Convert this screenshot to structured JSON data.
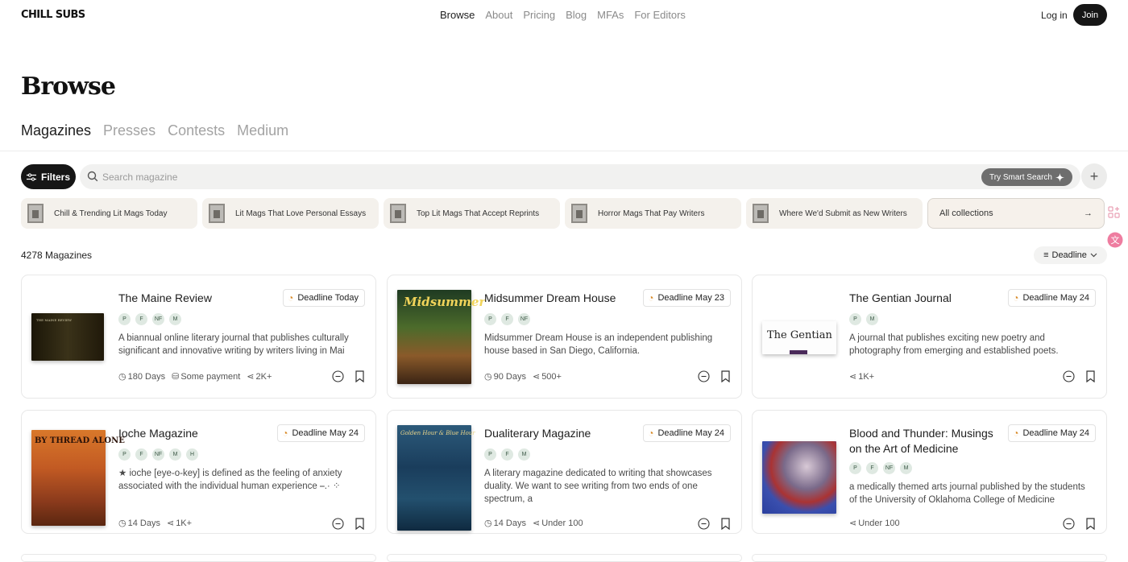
{
  "brand": "CHILL SUBS",
  "nav": [
    "Browse",
    "About",
    "Pricing",
    "Blog",
    "MFAs",
    "For Editors"
  ],
  "auth": {
    "login": "Log in",
    "join": "Join"
  },
  "page_title": "Browse",
  "tabs": [
    "Magazines",
    "Presses",
    "Contests",
    "Medium"
  ],
  "toolbar": {
    "filters": "Filters",
    "search_placeholder": "Search magazine",
    "smart_search": "Try Smart Search"
  },
  "collections": [
    "Chill & Trending Lit Mags Today",
    "Lit Mags That Love Personal Essays",
    "Top Lit Mags That Accept Reprints",
    "Horror Mags That Pay Writers",
    "Where We'd Submit as New Writers"
  ],
  "all_collections": "All collections",
  "result_count": "4278 Magazines",
  "sort_label": "Deadline",
  "cards": [
    {
      "name": "The Maine Review",
      "deadline": "Deadline Today",
      "tags": [
        "P",
        "F",
        "NF",
        "M"
      ],
      "desc": "A biannual online literary journal that publishes culturally significant and innovative writing by writers living in Mai",
      "days": "180 Days",
      "payment": "Some payment",
      "reach": "2K+",
      "cover_title": "THE MAINE REVIEW"
    },
    {
      "name": "Midsummer Dream House",
      "deadline": "Deadline May 23",
      "tags": [
        "P",
        "F",
        "NF"
      ],
      "desc": "Midsummer Dream House is an independent publishing house based in San Diego, California.",
      "days": "90 Days",
      "payment": "",
      "reach": "500+",
      "cover_title": "Midsummer"
    },
    {
      "name": "The Gentian Journal",
      "deadline": "Deadline May 24",
      "tags": [
        "P",
        "M"
      ],
      "desc": "A journal that publishes exciting new poetry and photography from emerging and established poets.",
      "days": "",
      "payment": "",
      "reach": "1K+",
      "cover_title": "The Gentian"
    },
    {
      "name": "Ioche Magazine",
      "deadline": "Deadline May 24",
      "tags": [
        "P",
        "F",
        "NF",
        "M",
        "H"
      ],
      "desc": "★ ioche [eye-o-key] is defined as the feeling of anxiety associated with the individual human experience ⎯.· ⁘",
      "days": "14 Days",
      "payment": "",
      "reach": "1K+",
      "cover_title": "BY THREAD ALONE"
    },
    {
      "name": "Dualiterary Magazine",
      "deadline": "Deadline May 24",
      "tags": [
        "P",
        "F",
        "M"
      ],
      "desc": "A literary magazine dedicated to writing that showcases duality. We want to see writing from two ends of one spectrum, a",
      "days": "14 Days",
      "payment": "",
      "reach": "Under 100",
      "cover_title": "Golden Hour & Blue Hour"
    },
    {
      "name": "Blood and Thunder: Musings on the Art of Medicine",
      "deadline": "Deadline May 24",
      "tags": [
        "P",
        "F",
        "NF",
        "M"
      ],
      "desc": "a medically themed arts journal published by the students of the University of Oklahoma College of Medicine",
      "days": "",
      "payment": "",
      "reach": "Under 100",
      "cover_title": ""
    }
  ]
}
